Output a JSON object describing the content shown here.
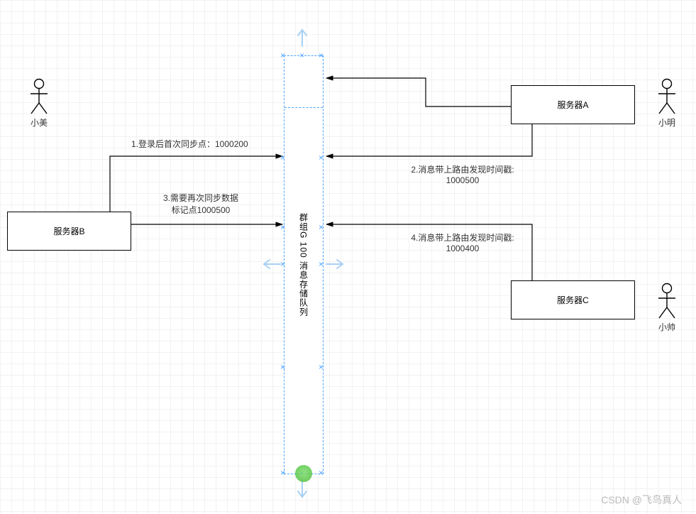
{
  "actors": {
    "left": {
      "name": "小美"
    },
    "rightTop": {
      "name": "小明"
    },
    "rightBottom": {
      "name": "小帅"
    }
  },
  "servers": {
    "b": "服务器B",
    "a": "服务器A",
    "c": "服务器C"
  },
  "queue": {
    "title": "群组G 100 消息存储队列"
  },
  "labels": {
    "l1": "1.登录后首次同步点：1000200",
    "l3a": "3.需要再次同步数据",
    "l3b": "标记点1000500",
    "l2a": "2.消息带上路由发现时间戳:",
    "l2b": "1000500",
    "l4a": "4.消息带上路由发现时间戳:",
    "l4b": "1000400"
  },
  "watermark": "CSDN @飞鸟真人"
}
